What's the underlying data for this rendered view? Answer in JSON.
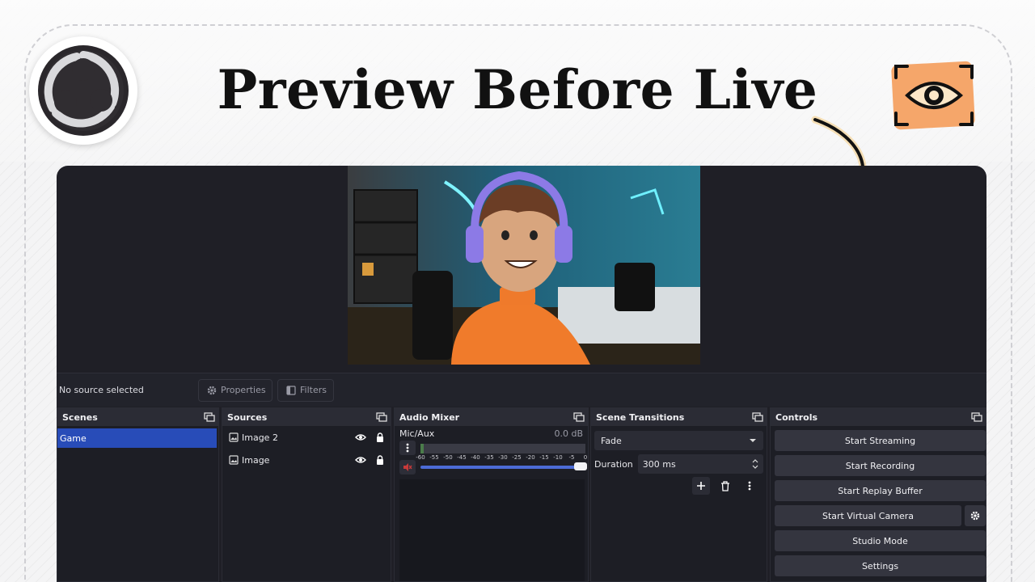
{
  "headline": "Preview Before Live",
  "obs": {
    "status": {
      "no_source": "No source selected",
      "properties_label": "Properties",
      "filters_label": "Filters"
    },
    "scenes": {
      "title": "Scenes",
      "items": [
        "Game"
      ]
    },
    "sources": {
      "title": "Sources",
      "items": [
        "Image 2",
        "Image"
      ]
    },
    "audio_mixer": {
      "title": "Audio Mixer",
      "channel": "Mic/Aux",
      "level": "0.0 dB",
      "scale": [
        "-60",
        "-55",
        "-50",
        "-45",
        "-40",
        "-35",
        "-30",
        "-25",
        "-20",
        "-15",
        "-10",
        "-5",
        "0"
      ],
      "volume_fraction": 1.0
    },
    "scene_transitions": {
      "title": "Scene Transitions",
      "transition": "Fade",
      "duration_label": "Duration",
      "duration_value": "300 ms"
    },
    "controls": {
      "title": "Controls",
      "start_streaming": "Start Streaming",
      "start_recording": "Start Recording",
      "start_replay_buffer": "Start Replay Buffer",
      "start_virtual_camera": "Start Virtual Camera",
      "studio_mode": "Studio Mode",
      "settings": "Settings"
    }
  },
  "colors": {
    "accent_blue": "#284cb8",
    "obs_bg": "#1f1f26",
    "badge_orange": "#f5a66a",
    "arrow_glow": "#f3b23a"
  },
  "icons": [
    "obs-logo-icon",
    "eye-badge-icon",
    "curved-arrow-icon",
    "gear-icon",
    "filter-icon",
    "image-icon",
    "eye-icon",
    "lock-icon",
    "dock-icon",
    "kebab-icon",
    "mute-icon",
    "plus-icon",
    "trash-icon",
    "chevron-down-icon",
    "spin-icon"
  ]
}
